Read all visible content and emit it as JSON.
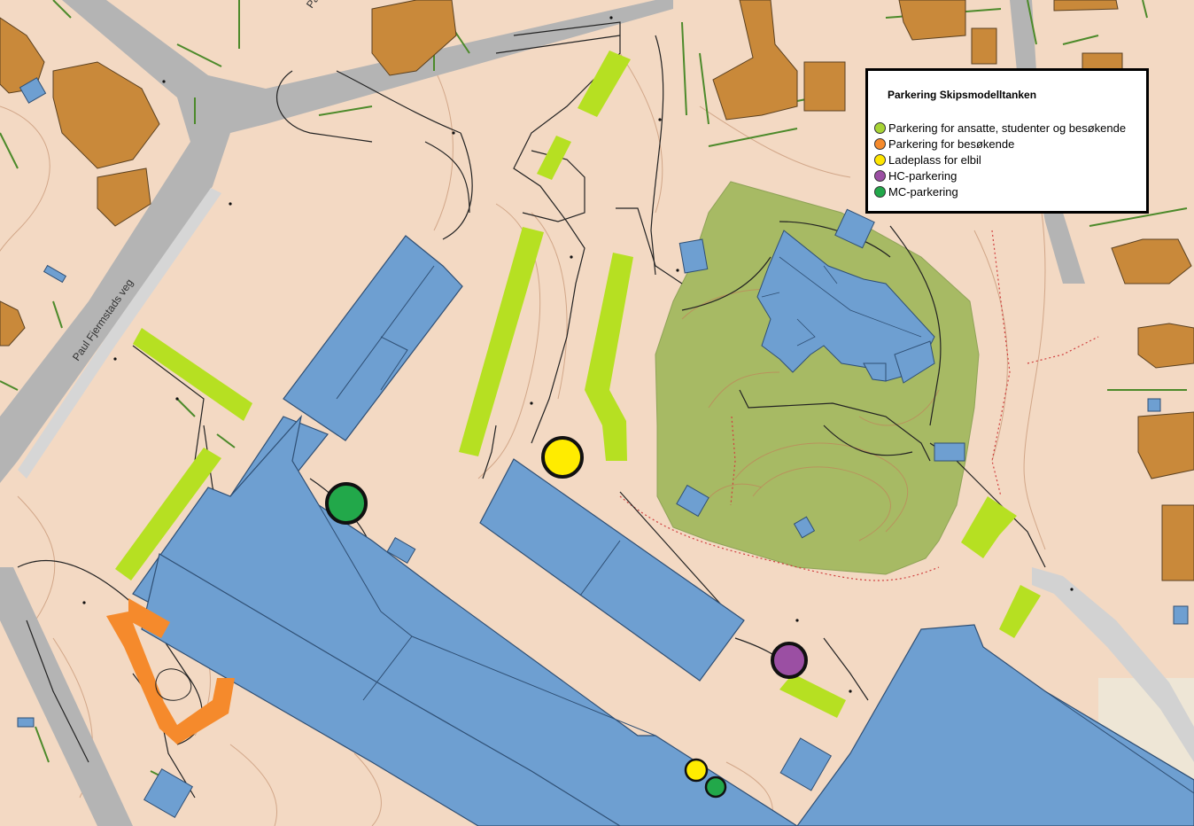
{
  "road_label": "Paul Fjermstads veg",
  "road_label_2": "Pa",
  "legend": {
    "title": "Parkering Skipsmodelltanken",
    "items": [
      {
        "label": "Parkering for ansatte, studenter og besøkende",
        "color": "#a7d435"
      },
      {
        "label": "Parkering for besøkende",
        "color": "#f58a2c"
      },
      {
        "label": "Ladeplass for elbil",
        "color": "#ffe600"
      },
      {
        "label": "HC-parkering",
        "color": "#9b4fa3"
      },
      {
        "label": "MC-parkering",
        "color": "#22a84a"
      }
    ]
  },
  "colors": {
    "background": "#f3d9c3",
    "road": "#b4b4b4",
    "building_blue": "#6e9fd1",
    "building_brown": "#c9893a",
    "park_green": "#a7ba64",
    "parking_green": "#b6e022",
    "parking_orange": "#f58a2c",
    "ev_yellow": "#ffec00",
    "hc_purple": "#9b4fa3",
    "mc_green": "#22a84a"
  }
}
